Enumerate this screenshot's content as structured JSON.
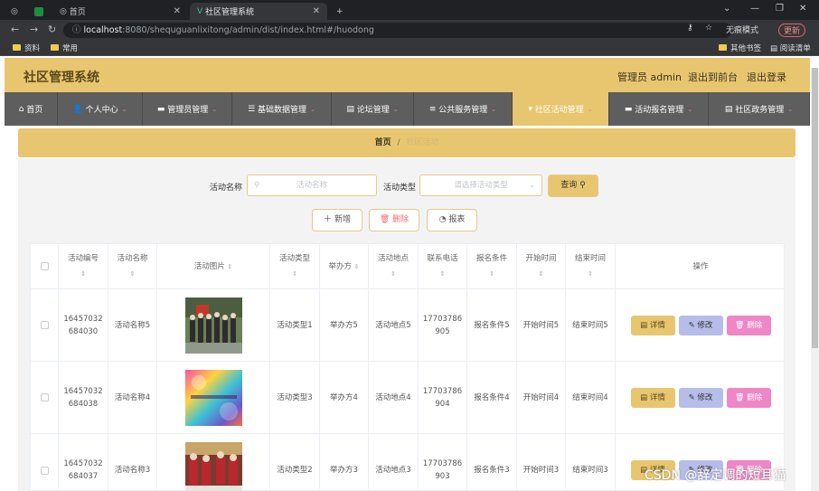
{
  "browser": {
    "tabs": [
      {
        "title": "首页"
      },
      {
        "title": "社区管理系统"
      }
    ],
    "url_host": "localhost",
    "url_rest": ":8080/shequguanlixitong/admin/dist/index.html#/huodong",
    "incognito": "无痕模式",
    "update": "更新",
    "bookmarks": [
      "资料",
      "常用"
    ],
    "other_bookmarks": "其他书签",
    "reading_list": "阅读清单"
  },
  "header": {
    "title": "社区管理系统",
    "user": "管理员 admin",
    "front": "退出到前台",
    "logout": "退出登录"
  },
  "menu": [
    {
      "label": "首页"
    },
    {
      "label": "个人中心"
    },
    {
      "label": "管理员管理"
    },
    {
      "label": "基础数据管理"
    },
    {
      "label": "论坛管理"
    },
    {
      "label": "公共服务管理"
    },
    {
      "label": "社区活动管理"
    },
    {
      "label": "活动报名管理"
    },
    {
      "label": "社区政务管理"
    }
  ],
  "breadcrumb": {
    "home": "首页",
    "sep": "/",
    "current": "社区活动"
  },
  "search": {
    "name_label": "活动名称",
    "name_placeholder": "活动名称",
    "type_label": "活动类型",
    "type_placeholder": "请选择活动类型",
    "query": "查询"
  },
  "actions": {
    "add": "新增",
    "delete": "删除",
    "report": "报表"
  },
  "table": {
    "headers": [
      "活动编号",
      "活动名称",
      "活动图片",
      "活动类型",
      "举办方",
      "活动地点",
      "联系电话",
      "报名条件",
      "开始时间",
      "结束时间",
      "操作"
    ],
    "rows": [
      {
        "id1": "16457032",
        "id2": "684030",
        "name": "活动名称5",
        "type": "活动类型1",
        "host": "举办方5",
        "place": "活动地点5",
        "ph1": "17703786",
        "ph2": "905",
        "cond": "报名条件5",
        "start": "开始时间5",
        "end": "结束时间5"
      },
      {
        "id1": "16457032",
        "id2": "684038",
        "name": "活动名称4",
        "type": "活动类型3",
        "host": "举办方4",
        "place": "活动地点4",
        "ph1": "17703786",
        "ph2": "904",
        "cond": "报名条件4",
        "start": "开始时间4",
        "end": "结束时间4"
      },
      {
        "id1": "16457032",
        "id2": "684037",
        "name": "活动名称3",
        "type": "活动类型2",
        "host": "举办方3",
        "place": "活动地点3",
        "ph1": "17703786",
        "ph2": "903",
        "cond": "报名条件3",
        "start": "开始时间3",
        "end": "结束时间3"
      }
    ],
    "btn_detail": "详情",
    "btn_edit": "修改",
    "btn_delete": "删除"
  },
  "watermark": "CSDN @辞定调的短耳猫",
  "colors": {
    "accent": "#e8c66f",
    "menu_bg": "#5e5e5e",
    "detail": "#e8c66f",
    "edit": "#b6bde8",
    "delete": "#ef86c6"
  }
}
